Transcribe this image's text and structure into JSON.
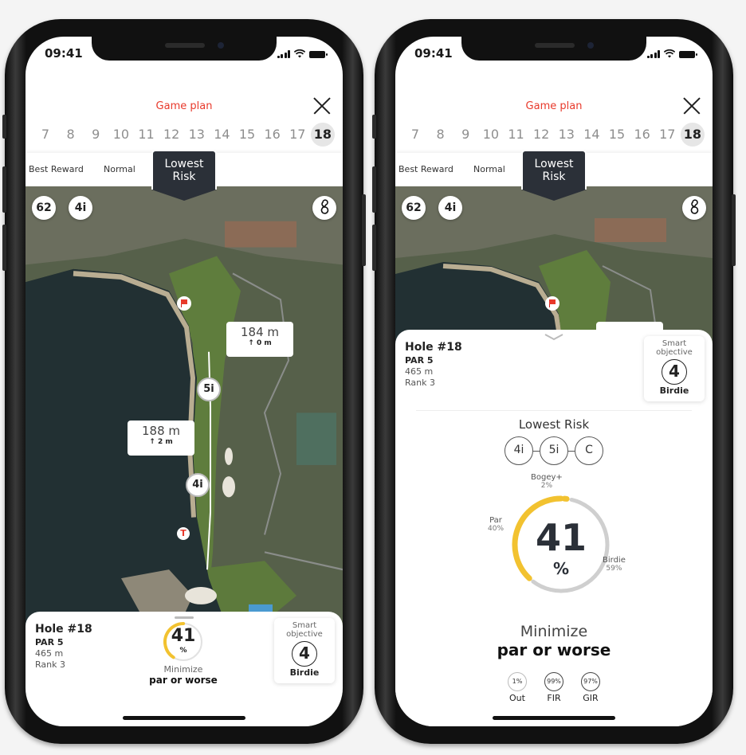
{
  "status_bar": {
    "time": "09:41"
  },
  "header": {
    "title": "Game plan",
    "close_icon": "close-icon"
  },
  "holes": [
    "7",
    "8",
    "9",
    "10",
    "11",
    "12",
    "13",
    "14",
    "15",
    "16",
    "17",
    "18"
  ],
  "active_hole": "18",
  "strategies": {
    "best_reward": "Best Reward",
    "normal": "Normal",
    "lowest_risk_line1": "Lowest",
    "lowest_risk_line2": "Risk"
  },
  "map": {
    "chips": {
      "score": "62",
      "club": "4i",
      "club_icon": "golf-bag-icon"
    },
    "markers": [
      {
        "club": "5i"
      },
      {
        "club": "4i"
      }
    ],
    "distances": [
      {
        "distance": "184 m",
        "elevation": "0 m"
      },
      {
        "distance": "188 m",
        "elevation": "2 m"
      }
    ],
    "pin_icon": "flag-icon",
    "tee_icon": "tee-icon"
  },
  "hole_info": {
    "title": "Hole #18",
    "par": "PAR 5",
    "length": "465 m",
    "rank": "Rank 3"
  },
  "smart_objective": {
    "label_line1": "Smart",
    "label_line2": "objective",
    "strokes": "4",
    "result": "Birdie"
  },
  "left_summary": {
    "probability": "41",
    "unit": "%",
    "caption_line1": "Minimize",
    "caption_line2": "par or worse"
  },
  "detail": {
    "plan_title": "Lowest Risk",
    "clubs": [
      "4i",
      "5i",
      "C"
    ],
    "gauge": {
      "value": "41",
      "unit": "%",
      "segments": [
        {
          "label": "Bogey+",
          "percent": "2%",
          "value": 2,
          "color": "#f2c230"
        },
        {
          "label": "Par",
          "percent": "40%",
          "value": 40,
          "color": "#f2c230"
        },
        {
          "label": "Birdie",
          "percent": "59%",
          "value": 59,
          "color": "#cfcfcf"
        }
      ]
    },
    "caption_line1": "Minimize",
    "caption_line2": "par or worse",
    "stats": [
      {
        "value": "1%",
        "name": "Out"
      },
      {
        "value": "99%",
        "name": "FIR"
      },
      {
        "value": "97%",
        "name": "GIR"
      }
    ]
  },
  "colors": {
    "accent": "#e8392b",
    "dark": "#2b3038",
    "gauge_yellow": "#f2c230",
    "gauge_grey": "#cfcfcf"
  }
}
